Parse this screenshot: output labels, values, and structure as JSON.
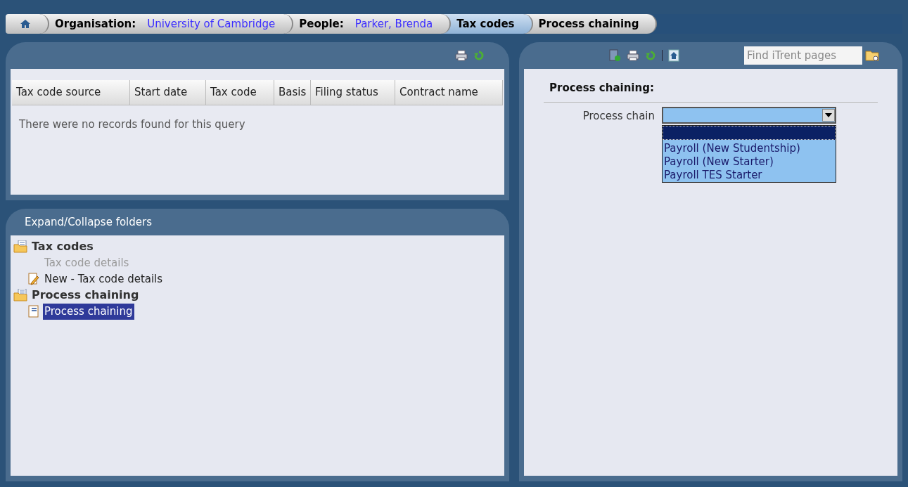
{
  "breadcrumb": [
    {
      "kind": "home",
      "selected": false
    },
    {
      "kind": "pair",
      "label": "Organisation:",
      "value": "University of Cambridge",
      "selected": false
    },
    {
      "kind": "pair",
      "label": "People:",
      "value": "Parker, Brenda",
      "selected": false
    },
    {
      "kind": "text",
      "label": "Tax codes",
      "selected": true
    },
    {
      "kind": "text",
      "label": "Process chaining",
      "selected": false
    }
  ],
  "results": {
    "columns": [
      "Tax code source",
      "Start date",
      "Tax code",
      "Basis",
      "Filing status",
      "Contract name"
    ],
    "empty_message": "There were no records found for this query"
  },
  "folders_panel": {
    "title": "Expand/Collapse folders",
    "tree": [
      {
        "label": "Tax codes",
        "children": [
          {
            "label": "Tax code details",
            "kind": "plain",
            "disabled": true,
            "selected": false
          },
          {
            "label": "New - Tax code details",
            "kind": "new",
            "disabled": false,
            "selected": false
          }
        ]
      },
      {
        "label": "Process chaining",
        "children": [
          {
            "label": "Process chaining",
            "kind": "page",
            "disabled": false,
            "selected": true
          }
        ]
      }
    ]
  },
  "search": {
    "placeholder": "Find iTrent pages"
  },
  "form": {
    "title": "Process chaining:",
    "field_label": "Process chain",
    "dropdown": {
      "expanded": true,
      "blank_option_highlighted": true,
      "options": [
        {
          "label": "Payroll (New Studentship)",
          "selected": false
        },
        {
          "label": "Payroll (New Starter)",
          "selected": false
        },
        {
          "label": "Payroll TES Starter",
          "selected": false
        }
      ]
    }
  }
}
